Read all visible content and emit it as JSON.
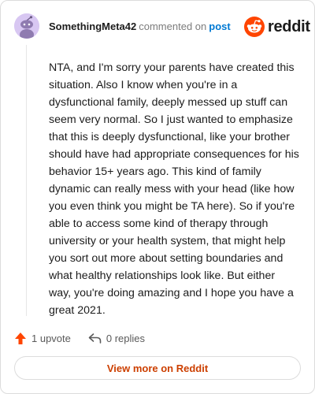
{
  "header": {
    "username": "SomethingMeta42",
    "commented_text": "commented on",
    "post_link": "post"
  },
  "brand": {
    "wordmark": "reddit",
    "color": "#ff4500"
  },
  "comment": {
    "body": "NTA, and I'm sorry your parents have created this situation. Also I know when you're in a dysfunctional family, deeply messed up stuff can seem very normal. So I just wanted to emphasize that this is deeply dysfunctional, like your brother should have had appropriate consequences for his behavior 15+ years ago. This kind of family dynamic can really mess with your head (like how you even think you might be TA here). So if you're able to access some kind of therapy through university or your health system, that might help you sort out more about setting boundaries and what healthy relationships look like. But either way, you're doing amazing and I hope you have a great 2021."
  },
  "actions": {
    "upvote_label": "1 upvote",
    "replies_label": "0 replies",
    "upvote_icon": "upvote-arrow-icon",
    "reply_icon": "reply-arrow-icon"
  },
  "footer": {
    "view_more_label": "View more on Reddit"
  },
  "colors": {
    "upvote": "#ff4500",
    "view_more_text": "#cc3f00",
    "link": "#0079d3",
    "avatar_bg": "#d8c7f2"
  }
}
